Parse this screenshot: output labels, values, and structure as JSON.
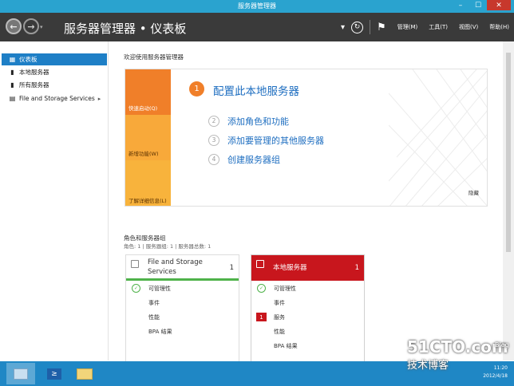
{
  "window": {
    "title": "服务器管理器",
    "min_glyph": "–",
    "max_glyph": "☐",
    "close_glyph": "✕"
  },
  "header": {
    "breadcrumb": "服务器管理器 • 仪表板",
    "back_glyph": "←",
    "forward_glyph": "→",
    "dropdown_glyph": "▾",
    "refresh_glyph": "↻",
    "flag_glyph": "⚑",
    "menus": [
      "管理(M)",
      "工具(T)",
      "视图(V)",
      "帮助(H)"
    ]
  },
  "sidebar": {
    "items": [
      {
        "label": "仪表板",
        "icon": "dashboard-icon",
        "glyph": "▦",
        "active": true
      },
      {
        "label": "本地服务器",
        "icon": "server-icon",
        "glyph": "▮",
        "active": false
      },
      {
        "label": "所有服务器",
        "icon": "servers-icon",
        "glyph": "▮",
        "active": false
      },
      {
        "label": "File and Storage Services",
        "icon": "storage-icon",
        "glyph": "▤",
        "active": false,
        "chevron": "▸"
      }
    ]
  },
  "welcome": {
    "title": "欢迎使用服务器管理器",
    "tabs": [
      "快速启动(Q)",
      "新增功能(W)",
      "了解详细信息(L)"
    ],
    "main_step": {
      "number": "1",
      "label": "配置此本地服务器"
    },
    "steps": [
      {
        "number": "2",
        "label": "添加角色和功能"
      },
      {
        "number": "3",
        "label": "添加要管理的其他服务器"
      },
      {
        "number": "4",
        "label": "创建服务器组"
      }
    ],
    "hide_label": "隐藏"
  },
  "roles": {
    "title": "角色和服务器组",
    "subtitle": "角色: 1 | 服务器组: 1 | 服务器总数: 1",
    "tiles": [
      {
        "name": "File and Storage Services",
        "count": "1",
        "rows": [
          "可管理性",
          "事件",
          "性能",
          "BPA 结果"
        ],
        "status_glyph": "✓"
      },
      {
        "name": "本地服务器",
        "count": "1",
        "rows": [
          "可管理性",
          "事件",
          "服务",
          "性能",
          "BPA 结果"
        ],
        "status_glyph": "✓",
        "alert_count": "1"
      }
    ]
  },
  "taskbar": {
    "ps_glyph": "≥",
    "clock_time": "11:20",
    "clock_date": "2012/4/18"
  },
  "watermark": {
    "site": "51CTO.com",
    "tagline": "技术博客",
    "blog": "Blog"
  },
  "colors": {
    "accent": "#1e7fc6",
    "orange": "#f07f29",
    "red": "#c8161d",
    "green": "#4fb24a"
  }
}
